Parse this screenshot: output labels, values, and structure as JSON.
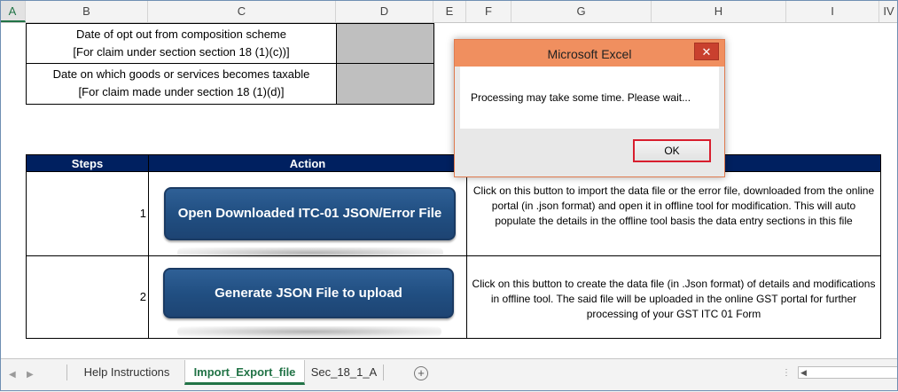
{
  "columns": [
    "A",
    "B",
    "C",
    "D",
    "E",
    "F",
    "G",
    "H",
    "I",
    "IV"
  ],
  "top_table": {
    "row1_line1": "Date of opt out from composition scheme",
    "row1_line2": "[For claim under section  section 18 (1)(c))]",
    "row2_line1": "Date on which goods or services becomes taxable",
    "row2_line2": "[For claim made under section 18 (1)(d)]"
  },
  "steps_table": {
    "header_steps": "Steps",
    "header_action": "Action",
    "rows": [
      {
        "step": "1",
        "button_label": "Open Downloaded ITC-01 JSON/Error File",
        "description": "Click on this button to import the data file or the error file, downloaded from the online portal (in .json format) and open it in offline tool for modification. This will auto populate the details in the offline tool basis the data entry sections in this file"
      },
      {
        "step": "2",
        "button_label": "Generate JSON File to upload",
        "description": "Click on this button to create the data file (in .Json format) of details and modifications in offline tool. The said file will be uploaded in the online GST portal for further processing of your GST ITC 01 Form"
      }
    ]
  },
  "dialog": {
    "title": "Microsoft Excel",
    "close_symbol": "✕",
    "message": "Processing may take some time. Please wait...",
    "ok_label": "OK"
  },
  "tabs": {
    "items": [
      "Help Instructions",
      "Import_Export_file",
      "Sec_18_1_A"
    ],
    "active": "Import_Export_file",
    "add_symbol": "+"
  },
  "colors": {
    "header_navy": "#002060",
    "button_blue": "#214f82",
    "dialog_title": "#f08f5f",
    "excel_green": "#217346"
  }
}
